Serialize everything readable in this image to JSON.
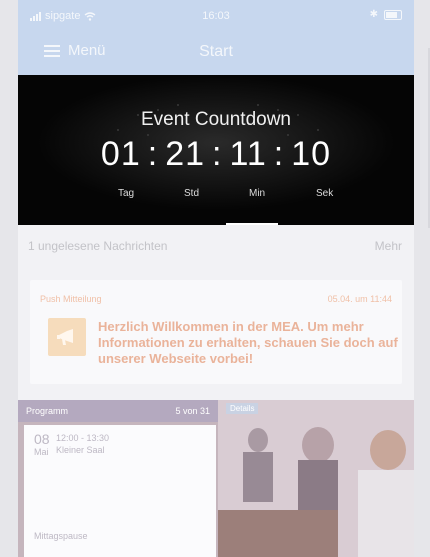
{
  "status_bar": {
    "carrier": "sipgate",
    "time": "16:03"
  },
  "nav": {
    "menu_label": "Menü",
    "title": "Start"
  },
  "countdown": {
    "title": "Event Countdown",
    "days": "01",
    "hours": "21",
    "minutes": "11",
    "seconds": "10",
    "days_label": "Tag",
    "hours_label": "Std",
    "minutes_label": "Min",
    "seconds_label": "Sek"
  },
  "messages": {
    "unread_text": "1 ungelesene Nachrichten",
    "more_label": "Mehr",
    "card": {
      "type": "Push Mitteilung",
      "date": "05.04. um 11:44",
      "text": "Herzlich Willkommen in der MEA. Um mehr Informationen zu erhalten, schauen Sie doch auf unserer Webseite vorbei!"
    }
  },
  "program": {
    "title": "Programm",
    "counter": "5 von 31",
    "details_label": "Details",
    "entry": {
      "day": "08",
      "month": "Mai",
      "time": "12:00 - 13:30",
      "room": "Kleiner Saal",
      "item": "Mittagspause"
    }
  },
  "colors": {
    "nav_bar": "#c7d7ee",
    "countdown_bg": "#050505",
    "accent": "#eab39a",
    "program_header": "#b4a9bf"
  },
  "icons": [
    "wifi-icon",
    "bluetooth-icon",
    "battery-icon",
    "menu-icon",
    "megaphone-icon"
  ]
}
